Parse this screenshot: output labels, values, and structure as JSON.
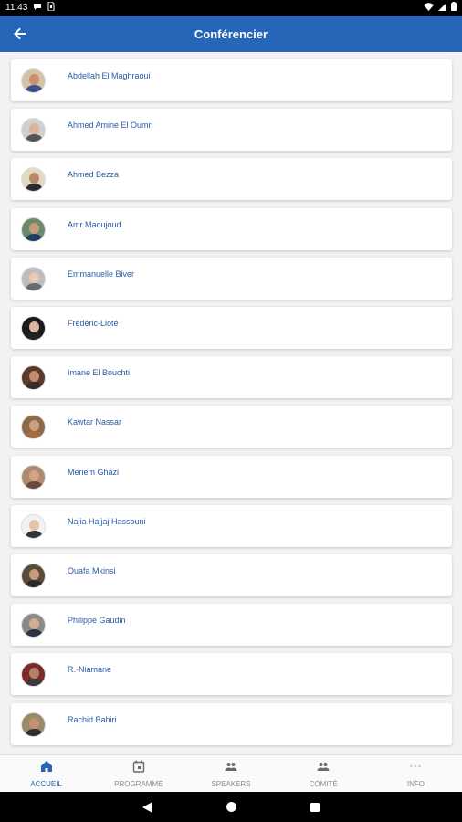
{
  "status_bar": {
    "time": "11:43"
  },
  "app_bar": {
    "title": "Conférencier"
  },
  "speakers": [
    {
      "name": "Abdellah El Maghraoui",
      "skin": "#c98f6e",
      "shirt": "#3a4f8c",
      "bg": "#d6c2a8"
    },
    {
      "name": "Ahmed Amine El Oumri",
      "skin": "#d9b49a",
      "shirt": "#555555",
      "bg": "#cfcfcf"
    },
    {
      "name": "Ahmed Bezza",
      "skin": "#b98a6a",
      "shirt": "#2c2c2c",
      "bg": "#e3d9c6"
    },
    {
      "name": "Amr Maoujoud",
      "skin": "#c69c80",
      "shirt": "#1f3f5f",
      "bg": "#6c8a6c"
    },
    {
      "name": "Emmanuelle Biver",
      "skin": "#e8c9b5",
      "shirt": "#666a70",
      "bg": "#bdbdbd"
    },
    {
      "name": "Frédéric-Lioté",
      "skin": "#d8b6a0",
      "shirt": "#222222",
      "bg": "#1a1a1a"
    },
    {
      "name": "Imane El Bouchti",
      "skin": "#c18d70",
      "shirt": "#3b2a24",
      "bg": "#5a3a2a"
    },
    {
      "name": "Kawtar Nassar",
      "skin": "#c9a07f",
      "shirt": "#a86b3f",
      "bg": "#8c6a4a"
    },
    {
      "name": "Meriem Ghazi",
      "skin": "#d3a387",
      "shirt": "#6a4a3a",
      "bg": "#b08a70"
    },
    {
      "name": "Najia Hajjaj Hassouni",
      "skin": "#e2c3a8",
      "shirt": "#333333",
      "bg": "#f2f2f2"
    },
    {
      "name": "Ouafa Mkinsi",
      "skin": "#c79b7c",
      "shirt": "#2a2a2a",
      "bg": "#5a4a3a"
    },
    {
      "name": "Philippe Gaudin",
      "skin": "#d4ac92",
      "shirt": "#2b3345",
      "bg": "#8a8a8a"
    },
    {
      "name": "R.-Niamane",
      "skin": "#b78168",
      "shirt": "#3a3a3a",
      "bg": "#7a2a2a"
    },
    {
      "name": "Rachid Bahiri",
      "skin": "#c49270",
      "shirt": "#2f2f2f",
      "bg": "#9a8a6a"
    }
  ],
  "bottom_nav": [
    {
      "label": "ACCUEIL",
      "icon": "home-icon",
      "active": true
    },
    {
      "label": "PROGRAMME",
      "icon": "calendar-icon",
      "active": false
    },
    {
      "label": "SPEAKERS",
      "icon": "people-icon",
      "active": false
    },
    {
      "label": "COMITÉ",
      "icon": "group-icon",
      "active": false
    },
    {
      "label": "INFO",
      "icon": "more-icon",
      "active": false
    }
  ],
  "colors": {
    "primary": "#2566b8",
    "name_text": "#2a5aa6",
    "inactive": "#8a8a8a"
  }
}
